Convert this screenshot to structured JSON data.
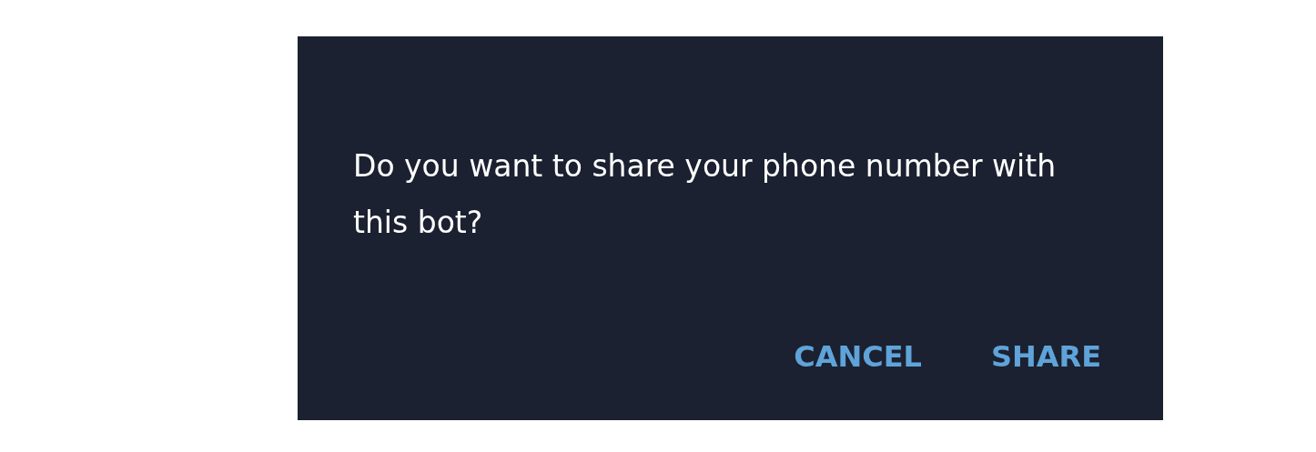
{
  "dialog": {
    "message": "Do you want to share your phone number with this bot?",
    "buttons": [
      {
        "label": "CANCEL"
      },
      {
        "label": "SHARE"
      }
    ]
  }
}
